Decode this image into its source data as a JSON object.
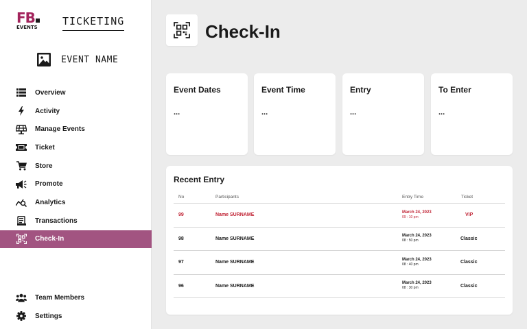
{
  "brand": {
    "logo_top": "FB",
    "logo_bottom": "EVENTS",
    "title": "TICKETING",
    "accent": "#a3245c"
  },
  "event": {
    "name": "EVENT NAME",
    "icon": "image-icon"
  },
  "nav": {
    "items": [
      {
        "label": "Overview",
        "icon": "list-icon"
      },
      {
        "label": "Activity",
        "icon": "bolt-icon"
      },
      {
        "label": "Manage Events",
        "icon": "solar-panel-icon"
      },
      {
        "label": "Ticket",
        "icon": "ticket-icon"
      },
      {
        "label": "Store",
        "icon": "cart-icon"
      },
      {
        "label": "Promote",
        "icon": "megaphone-icon"
      },
      {
        "label": "Analytics",
        "icon": "analytics-icon"
      },
      {
        "label": "Transactions",
        "icon": "receipt-icon"
      },
      {
        "label": "Check-In",
        "icon": "qr-icon",
        "active": true
      }
    ],
    "bottom": [
      {
        "label": "Team Members",
        "icon": "team-icon"
      },
      {
        "label": "Settings",
        "icon": "gear-icon"
      }
    ],
    "active_color": "#a25481"
  },
  "page": {
    "title": "Check-In",
    "icon": "qr-icon"
  },
  "cards": [
    {
      "title": "Event Dates",
      "value": "..."
    },
    {
      "title": "Event Time",
      "value": "..."
    },
    {
      "title": "Entry",
      "value": "..."
    },
    {
      "title": "To Enter",
      "value": "..."
    }
  ],
  "recent": {
    "title": "Recent Entry",
    "columns": {
      "no": "No",
      "participants": "Participants",
      "entry_time": "Entry Time",
      "ticket": "Ticket"
    },
    "rows": [
      {
        "no": "99",
        "name": "Name SURNAME",
        "date": "March 24, 2023",
        "time": "09 : 10 pm",
        "ticket": "VIP",
        "highlight": true
      },
      {
        "no": "98",
        "name": "Name SURNAME",
        "date": "March 24, 2023",
        "time": "08 : 50 pm",
        "ticket": "Classic"
      },
      {
        "no": "97",
        "name": "Name SURNAME",
        "date": "March 24, 2023",
        "time": "08 : 40 pm",
        "ticket": "Classic"
      },
      {
        "no": "96",
        "name": "Name SURNAME",
        "date": "March 24, 2023",
        "time": "08 : 30 pm",
        "ticket": "Classic"
      }
    ],
    "highlight_color": "#c02334"
  }
}
